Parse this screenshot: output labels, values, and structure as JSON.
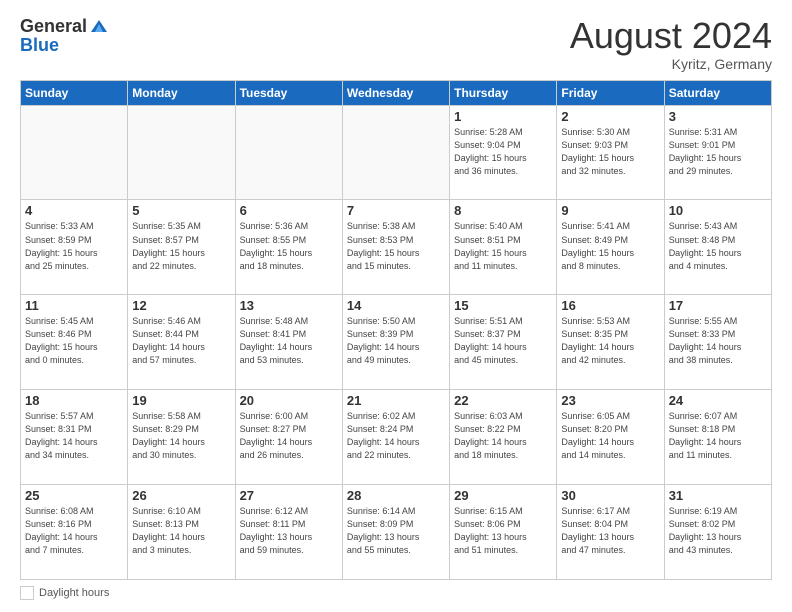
{
  "header": {
    "logo_general": "General",
    "logo_blue": "Blue",
    "month_title": "August 2024",
    "subtitle": "Kyritz, Germany"
  },
  "footer": {
    "daylight_label": "Daylight hours"
  },
  "days_of_week": [
    "Sunday",
    "Monday",
    "Tuesday",
    "Wednesday",
    "Thursday",
    "Friday",
    "Saturday"
  ],
  "weeks": [
    [
      {
        "day": "",
        "info": ""
      },
      {
        "day": "",
        "info": ""
      },
      {
        "day": "",
        "info": ""
      },
      {
        "day": "",
        "info": ""
      },
      {
        "day": "1",
        "info": "Sunrise: 5:28 AM\nSunset: 9:04 PM\nDaylight: 15 hours\nand 36 minutes."
      },
      {
        "day": "2",
        "info": "Sunrise: 5:30 AM\nSunset: 9:03 PM\nDaylight: 15 hours\nand 32 minutes."
      },
      {
        "day": "3",
        "info": "Sunrise: 5:31 AM\nSunset: 9:01 PM\nDaylight: 15 hours\nand 29 minutes."
      }
    ],
    [
      {
        "day": "4",
        "info": "Sunrise: 5:33 AM\nSunset: 8:59 PM\nDaylight: 15 hours\nand 25 minutes."
      },
      {
        "day": "5",
        "info": "Sunrise: 5:35 AM\nSunset: 8:57 PM\nDaylight: 15 hours\nand 22 minutes."
      },
      {
        "day": "6",
        "info": "Sunrise: 5:36 AM\nSunset: 8:55 PM\nDaylight: 15 hours\nand 18 minutes."
      },
      {
        "day": "7",
        "info": "Sunrise: 5:38 AM\nSunset: 8:53 PM\nDaylight: 15 hours\nand 15 minutes."
      },
      {
        "day": "8",
        "info": "Sunrise: 5:40 AM\nSunset: 8:51 PM\nDaylight: 15 hours\nand 11 minutes."
      },
      {
        "day": "9",
        "info": "Sunrise: 5:41 AM\nSunset: 8:49 PM\nDaylight: 15 hours\nand 8 minutes."
      },
      {
        "day": "10",
        "info": "Sunrise: 5:43 AM\nSunset: 8:48 PM\nDaylight: 15 hours\nand 4 minutes."
      }
    ],
    [
      {
        "day": "11",
        "info": "Sunrise: 5:45 AM\nSunset: 8:46 PM\nDaylight: 15 hours\nand 0 minutes."
      },
      {
        "day": "12",
        "info": "Sunrise: 5:46 AM\nSunset: 8:44 PM\nDaylight: 14 hours\nand 57 minutes."
      },
      {
        "day": "13",
        "info": "Sunrise: 5:48 AM\nSunset: 8:41 PM\nDaylight: 14 hours\nand 53 minutes."
      },
      {
        "day": "14",
        "info": "Sunrise: 5:50 AM\nSunset: 8:39 PM\nDaylight: 14 hours\nand 49 minutes."
      },
      {
        "day": "15",
        "info": "Sunrise: 5:51 AM\nSunset: 8:37 PM\nDaylight: 14 hours\nand 45 minutes."
      },
      {
        "day": "16",
        "info": "Sunrise: 5:53 AM\nSunset: 8:35 PM\nDaylight: 14 hours\nand 42 minutes."
      },
      {
        "day": "17",
        "info": "Sunrise: 5:55 AM\nSunset: 8:33 PM\nDaylight: 14 hours\nand 38 minutes."
      }
    ],
    [
      {
        "day": "18",
        "info": "Sunrise: 5:57 AM\nSunset: 8:31 PM\nDaylight: 14 hours\nand 34 minutes."
      },
      {
        "day": "19",
        "info": "Sunrise: 5:58 AM\nSunset: 8:29 PM\nDaylight: 14 hours\nand 30 minutes."
      },
      {
        "day": "20",
        "info": "Sunrise: 6:00 AM\nSunset: 8:27 PM\nDaylight: 14 hours\nand 26 minutes."
      },
      {
        "day": "21",
        "info": "Sunrise: 6:02 AM\nSunset: 8:24 PM\nDaylight: 14 hours\nand 22 minutes."
      },
      {
        "day": "22",
        "info": "Sunrise: 6:03 AM\nSunset: 8:22 PM\nDaylight: 14 hours\nand 18 minutes."
      },
      {
        "day": "23",
        "info": "Sunrise: 6:05 AM\nSunset: 8:20 PM\nDaylight: 14 hours\nand 14 minutes."
      },
      {
        "day": "24",
        "info": "Sunrise: 6:07 AM\nSunset: 8:18 PM\nDaylight: 14 hours\nand 11 minutes."
      }
    ],
    [
      {
        "day": "25",
        "info": "Sunrise: 6:08 AM\nSunset: 8:16 PM\nDaylight: 14 hours\nand 7 minutes."
      },
      {
        "day": "26",
        "info": "Sunrise: 6:10 AM\nSunset: 8:13 PM\nDaylight: 14 hours\nand 3 minutes."
      },
      {
        "day": "27",
        "info": "Sunrise: 6:12 AM\nSunset: 8:11 PM\nDaylight: 13 hours\nand 59 minutes."
      },
      {
        "day": "28",
        "info": "Sunrise: 6:14 AM\nSunset: 8:09 PM\nDaylight: 13 hours\nand 55 minutes."
      },
      {
        "day": "29",
        "info": "Sunrise: 6:15 AM\nSunset: 8:06 PM\nDaylight: 13 hours\nand 51 minutes."
      },
      {
        "day": "30",
        "info": "Sunrise: 6:17 AM\nSunset: 8:04 PM\nDaylight: 13 hours\nand 47 minutes."
      },
      {
        "day": "31",
        "info": "Sunrise: 6:19 AM\nSunset: 8:02 PM\nDaylight: 13 hours\nand 43 minutes."
      }
    ]
  ]
}
